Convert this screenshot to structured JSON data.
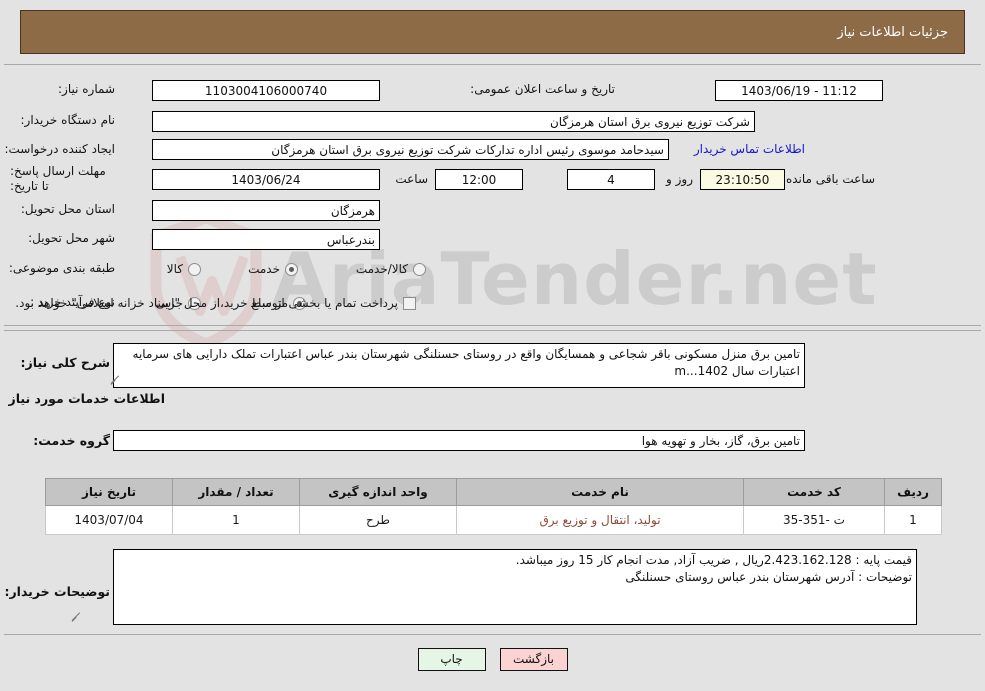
{
  "header": {
    "title": "جزئیات اطلاعات نیاز"
  },
  "form": {
    "need_number": {
      "label": "شماره نیاز:",
      "value": "1103004106000740"
    },
    "public_announce": {
      "label": "تاریخ و ساعت اعلان عمومی:",
      "value": "11:12 - 1403/06/19"
    },
    "buyer_org": {
      "label": "نام دستگاه خریدار:",
      "value": "شرکت توزیع نیروی برق استان هرمزگان"
    },
    "requester": {
      "label": "ایجاد کننده درخواست:",
      "value": "سیدحامد موسوی رئیس اداره تدارکات شرکت توزیع نیروی برق استان هرمزگان",
      "contact_link": "اطلاعات تماس خریدار"
    },
    "deadline": {
      "label": "مهلت ارسال پاسخ: تا تاریخ:",
      "date": "1403/06/24",
      "hour_label": "ساعت",
      "hour": "12:00",
      "days": "4",
      "days_label": "روز و",
      "countdown": "23:10:50",
      "countdown_label": "ساعت باقی مانده"
    },
    "delivery_province": {
      "label": "استان محل تحویل:",
      "value": "هرمزگان"
    },
    "delivery_city": {
      "label": "شهر محل تحویل:",
      "value": "بندرعباس"
    },
    "category": {
      "label": "طبقه بندی موضوعی:",
      "options": [
        "کالا",
        "خدمت",
        "کالا/خدمت"
      ],
      "selected": "خدمت"
    },
    "purchase_process": {
      "label": "نوع فرآیند خرید :",
      "options": [
        "جزیی",
        "متوسط"
      ],
      "selected": "متوسط",
      "checkbox_label": "پرداخت تمام یا بخشی از مبلغ خرید،از محل \"اسناد خزانه اسلامی\" خواهد بود.",
      "checkbox_checked": false
    }
  },
  "description": {
    "label": "شرح کلی نیاز:",
    "value": "تامین برق منزل مسکونی باقر شجاعی و همسایگان واقع در روستای حسنلنگی شهرستان بندر عباس اعتبارات تملک دارایی های سرمایه اعتبارات سال 1402...m"
  },
  "services_section": {
    "heading": "اطلاعات خدمات مورد نیاز",
    "service_group": {
      "label": "گروه خدمت:",
      "value": "تامین برق، گاز، بخار و تهویه هوا"
    }
  },
  "table": {
    "columns": [
      "ردیف",
      "کد خدمت",
      "نام خدمت",
      "واحد اندازه گیری",
      "تعداد / مقدار",
      "تاریخ نیاز"
    ],
    "rows": [
      {
        "row_no": "1",
        "service_code": "ت -351-35",
        "service_name": "تولید، انتقال و توزیع برق",
        "unit": "طرح",
        "quantity": "1",
        "need_date": "1403/07/04"
      }
    ]
  },
  "buyer_notes": {
    "label": "توضیحات خریدار:",
    "value": "قیمت پایه : 2.423.162.128ریال , ضریب آزاد, مدت انجام کار 15 روز میباشد.\nتوضیحات : آدرس شهرستان بندر عباس روستای حسنلنگی"
  },
  "footer": {
    "print_label": "چاپ",
    "return_label": "بازگشت"
  },
  "watermark": {
    "text": "AriaTender.net"
  },
  "colors": {
    "header_bar": "#8d6b47",
    "page_bg": "#e3e3e3",
    "link": "#1515d0",
    "table_header": "#c4c4c4",
    "service_name": "#8a4b38",
    "btn_print": "#e6f6e6",
    "btn_return": "#fbd3d3",
    "countdown_bg": "#fbfbe3"
  }
}
